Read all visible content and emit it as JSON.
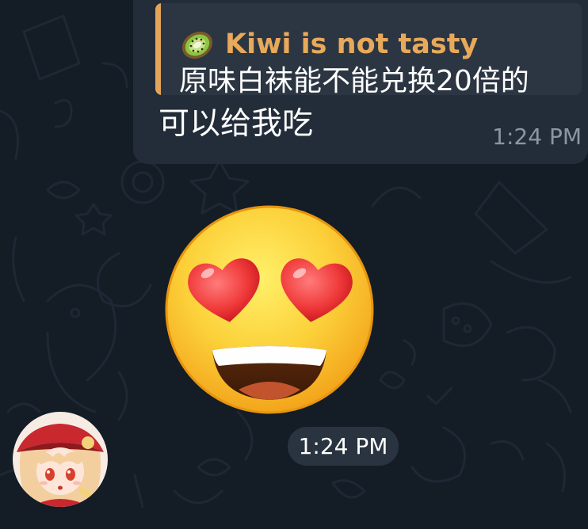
{
  "message": {
    "reply": {
      "author": "Kiwi is not tasty",
      "icon": "kiwi-icon",
      "text": "原味白袜能不能兑换20倍的"
    },
    "text": "可以给我吃",
    "time": "1:24 PM"
  },
  "sticker": {
    "emoji": "heart-eyes-emoji",
    "time": "1:24 PM"
  },
  "avatar": {
    "type": "anime-girl-avatar"
  },
  "colors": {
    "background": "#141c26",
    "bubble": "#232d39",
    "reply_bar": "#e2a55a",
    "reply_name": "#e8a95b",
    "time": "#8b96a5"
  }
}
